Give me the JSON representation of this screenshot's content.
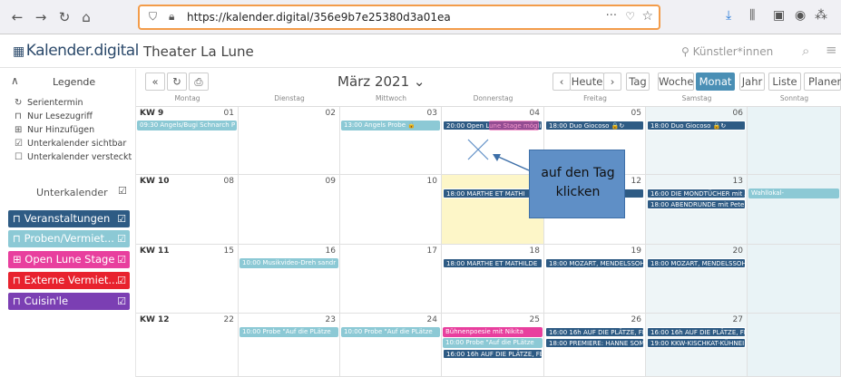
{
  "browser": {
    "url": "https://kalender.digital/356e9b7e25380d3a01ea",
    "back_icon": "arrow-left-icon",
    "forward_icon": "arrow-right-icon"
  },
  "app": {
    "logo": "Kalender.digital",
    "title": "Theater La Lune",
    "artists_label": "Künstler*innen"
  },
  "sidebar": {
    "legend_title": "Legende",
    "legend_items": [
      {
        "icon": "refresh-icon",
        "label": "Serientermin"
      },
      {
        "icon": "lock-icon",
        "label": "Nur Lesezugriff"
      },
      {
        "icon": "calendar-plus-icon",
        "label": "Nur Hinzufügen"
      },
      {
        "icon": "checkbox-checked-icon",
        "label": "Unterkalender sichtbar"
      },
      {
        "icon": "checkbox-empty-icon",
        "label": "Unterkalender versteckt"
      }
    ],
    "subcalendars_title": "Unterkalender",
    "subcalendars": [
      {
        "label": "Veranstaltungen",
        "color": "#2e5b84"
      },
      {
        "label": "Proben/Vermiet...",
        "color": "#8cc9d5"
      },
      {
        "label": "Open Lune Stage",
        "color": "#e83f9e"
      },
      {
        "label": "Externe Vermiet...",
        "color": "#e8222e"
      },
      {
        "label": "Cuisin'le",
        "color": "#7b3fb3"
      }
    ]
  },
  "toolbar": {
    "prev": "«",
    "month": "März 2021 ⌄",
    "today": "Heute",
    "views": [
      "Tag",
      "Woche",
      "Monat",
      "Jahr",
      "Liste",
      "Planer"
    ],
    "active_view": "Monat"
  },
  "weekdays": [
    "Montag",
    "Dienstag",
    "Mittwoch",
    "Donnerstag",
    "Freitag",
    "Samstag",
    "Sonntag"
  ],
  "weeks": [
    {
      "kw": "KW 9",
      "days": [
        "01",
        "02",
        "03",
        "04",
        "05",
        "06",
        ""
      ],
      "events": [
        {
          "day": 0,
          "row": 0,
          "style": "light",
          "text": "09:30 Angels/Bugi Schnarch P"
        },
        {
          "day": 2,
          "row": 0,
          "style": "light",
          "text": "13:00 Angels Probe 🔒"
        },
        {
          "day": 3,
          "row": 0,
          "style": "dark",
          "text": "20:00 Open Lune Stage mögli"
        },
        {
          "day": 4,
          "row": 0,
          "style": "dark",
          "text": "18:00 Duo Giocoso 🔒↻"
        },
        {
          "day": 5,
          "row": 0,
          "style": "dark",
          "text": "18:00 Duo Giocoso 🔒↻"
        }
      ]
    },
    {
      "kw": "KW 10",
      "days": [
        "08",
        "09",
        "10",
        "11",
        "12",
        "13",
        ""
      ],
      "events": [
        {
          "day": 3,
          "row": 0,
          "style": "dark",
          "text": "18:00 MARTHE ET MATHI"
        },
        {
          "day": 4,
          "row": 0,
          "style": "dark",
          "text": "s NAC"
        },
        {
          "day": 5,
          "row": 0,
          "style": "dark",
          "text": "16:00 DIE MONDTÜCHER mit A"
        },
        {
          "day": 6,
          "row": 0,
          "style": "light",
          "text": "Wahllokal-"
        },
        {
          "day": 5,
          "row": 1,
          "style": "dark",
          "text": "18:00 ABENDRUNDE mit Peter"
        }
      ]
    },
    {
      "kw": "KW 11",
      "days": [
        "15",
        "16",
        "17",
        "18",
        "19",
        "20",
        ""
      ],
      "events": [
        {
          "day": 1,
          "row": 0,
          "style": "light",
          "text": "10:00 Musikvideo-Dreh sandr"
        },
        {
          "day": 3,
          "row": 0,
          "style": "dark",
          "text": "18:00 MARTHE ET MATHILDE"
        },
        {
          "day": 4,
          "row": 0,
          "style": "dark",
          "text": "18:00 MOZART, MENDELSSOHN"
        },
        {
          "day": 5,
          "row": 0,
          "style": "dark",
          "text": "18:00 MOZART, MENDELSSOHN"
        }
      ]
    },
    {
      "kw": "KW 12",
      "days": [
        "22",
        "23",
        "24",
        "25",
        "26",
        "27",
        ""
      ],
      "events": [
        {
          "day": 1,
          "row": 0,
          "style": "light",
          "text": "10:00 Probe \"Auf die PLätze"
        },
        {
          "day": 2,
          "row": 0,
          "style": "light",
          "text": "10:00 Probe \"Auf die PLätze"
        },
        {
          "day": 3,
          "row": 0,
          "style": "pink",
          "text": "Bühnenpoesie mit Nikita"
        },
        {
          "day": 4,
          "row": 0,
          "style": "dark",
          "text": "16:00 16h AUF DIE PLÄTZE, FE"
        },
        {
          "day": 5,
          "row": 0,
          "style": "dark",
          "text": "16:00 16h AUF DIE PLÄTZE, FE"
        },
        {
          "day": 3,
          "row": 1,
          "style": "light",
          "text": "10:00 Probe \"Auf die PLätze"
        },
        {
          "day": 4,
          "row": 1,
          "style": "dark",
          "text": "18:00 PREMIERE: HANNE SOM"
        },
        {
          "day": 5,
          "row": 1,
          "style": "dark",
          "text": "19:00 KKW-KISCHKAT-KÜHNEI"
        },
        {
          "day": 3,
          "row": 2,
          "style": "dark",
          "text": "16:00 16h AUF DIE PLÄTZE, FE"
        }
      ]
    }
  ],
  "annotation": {
    "line1": "auf den Tag",
    "line2": "klicken"
  }
}
